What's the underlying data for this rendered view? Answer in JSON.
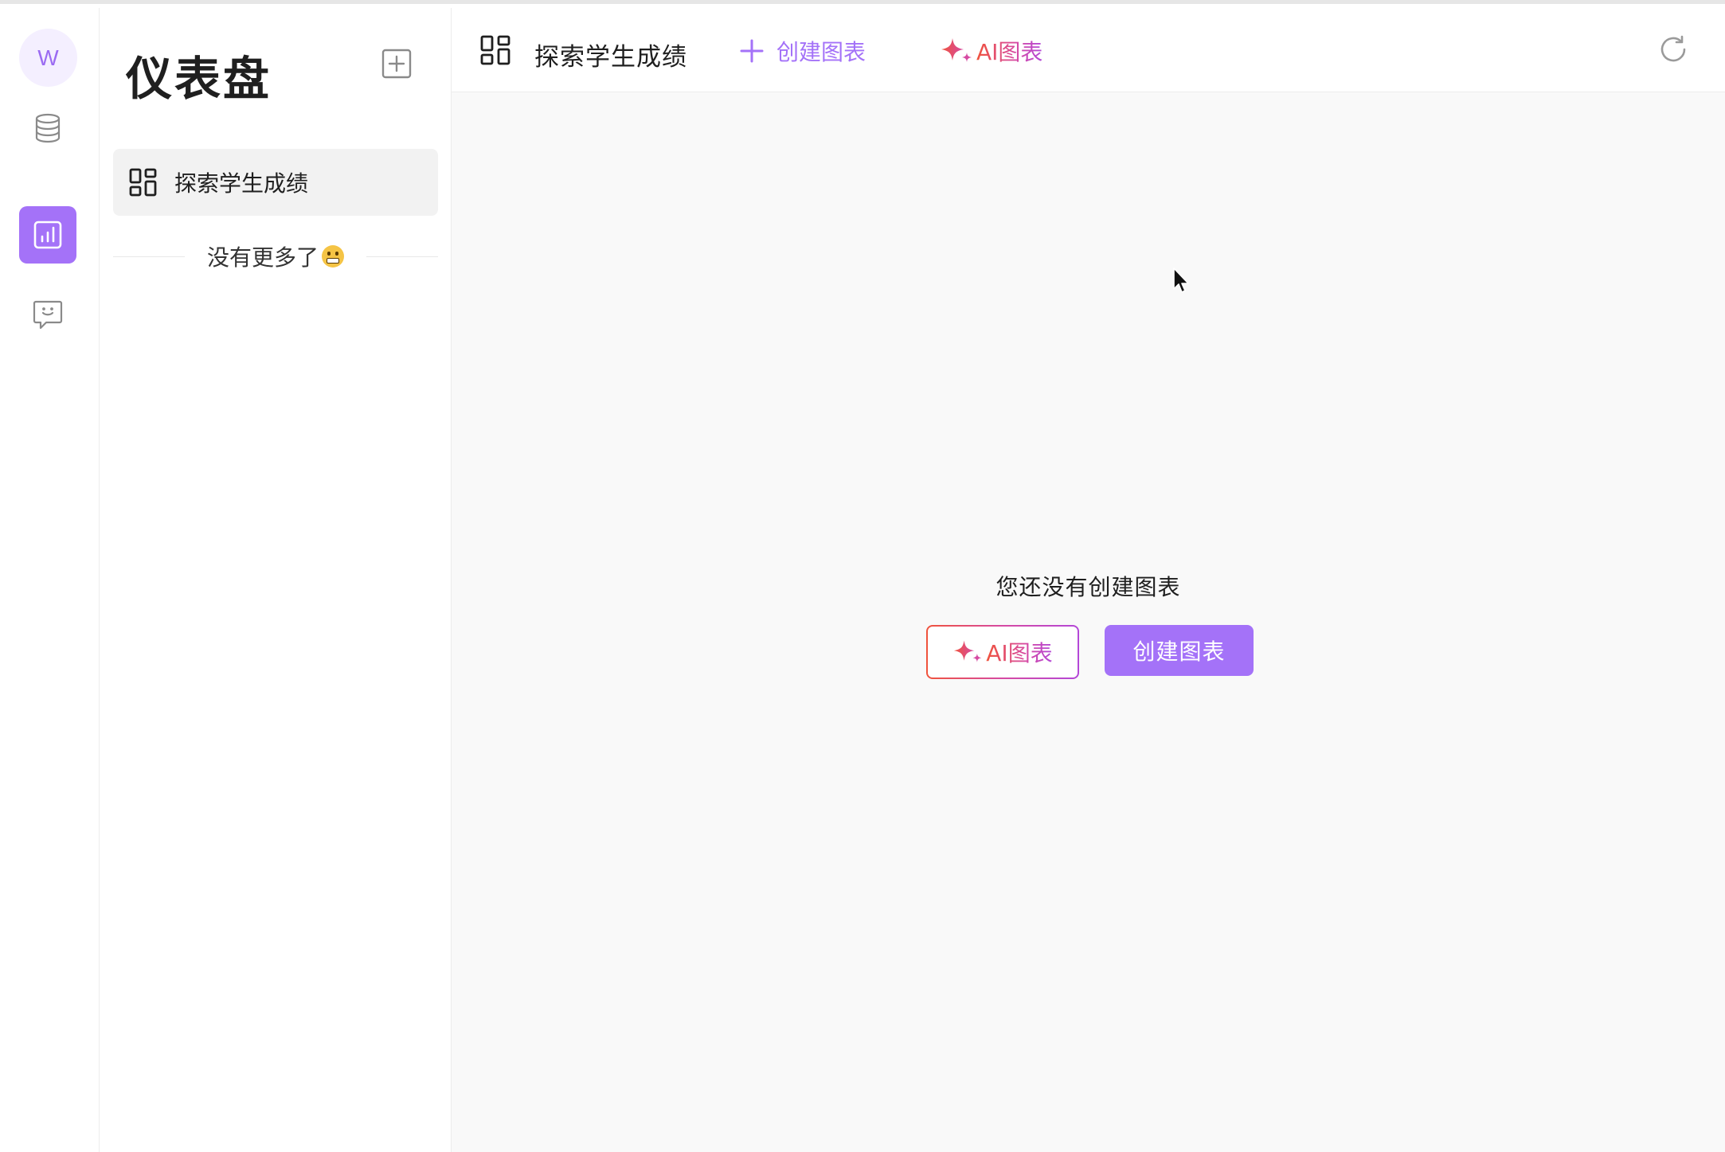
{
  "colors": {
    "accent": "#a472f8",
    "ai_gradient_start": "#f0533c",
    "ai_gradient_end": "#b347d8",
    "main_bg": "#f9f9f9"
  },
  "rail": {
    "avatar_letter": "W",
    "items": [
      {
        "icon": "database-icon"
      },
      {
        "icon": "bar-chart-icon",
        "active": true
      },
      {
        "icon": "chat-bot-icon"
      }
    ]
  },
  "panel": {
    "title": "仪表盘",
    "add_icon": "add-square-icon",
    "items": [
      {
        "label": "探索学生成绩",
        "icon": "dashboard-grid-icon",
        "selected": true
      }
    ],
    "no_more_text": "没有更多了"
  },
  "header": {
    "title": "探索学生成绩",
    "create_chart_label": "创建图表",
    "ai_chart_label": "AI图表",
    "refresh_icon": "refresh-icon"
  },
  "main": {
    "empty_text": "您还没有创建图表",
    "ai_chart_button": "AI图表",
    "create_chart_button": "创建图表"
  }
}
